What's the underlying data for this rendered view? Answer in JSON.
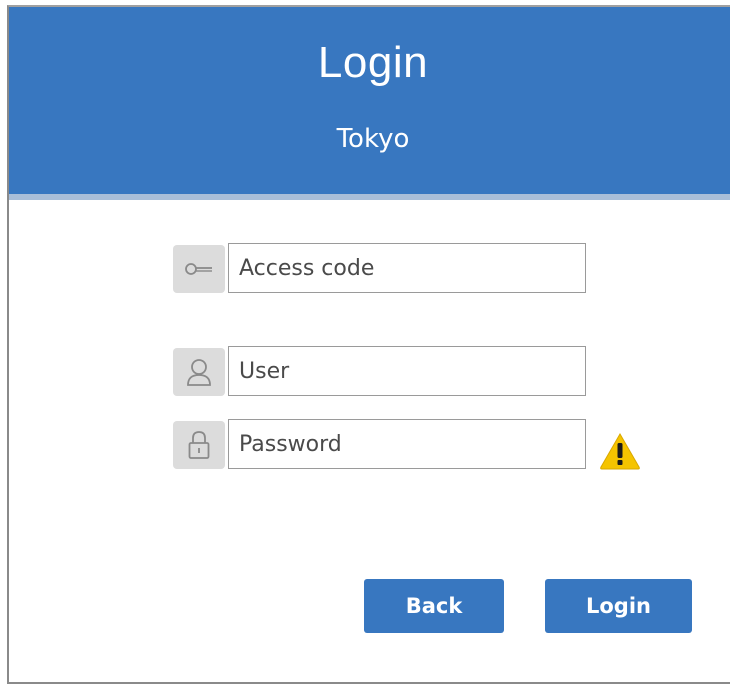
{
  "header": {
    "title": "Login",
    "location": "Tokyo",
    "background_color": "#3877c0"
  },
  "form": {
    "access_code": {
      "icon": "key-icon",
      "placeholder": "Access code",
      "value": ""
    },
    "user": {
      "icon": "user-icon",
      "placeholder": "User",
      "value": ""
    },
    "password": {
      "icon": "lock-icon",
      "placeholder": "Password",
      "value": ""
    },
    "warning_icon": "warning-icon",
    "warning_color": "#f5c400"
  },
  "actions": {
    "back_label": "Back",
    "login_label": "Login",
    "button_color": "#3877c0"
  }
}
